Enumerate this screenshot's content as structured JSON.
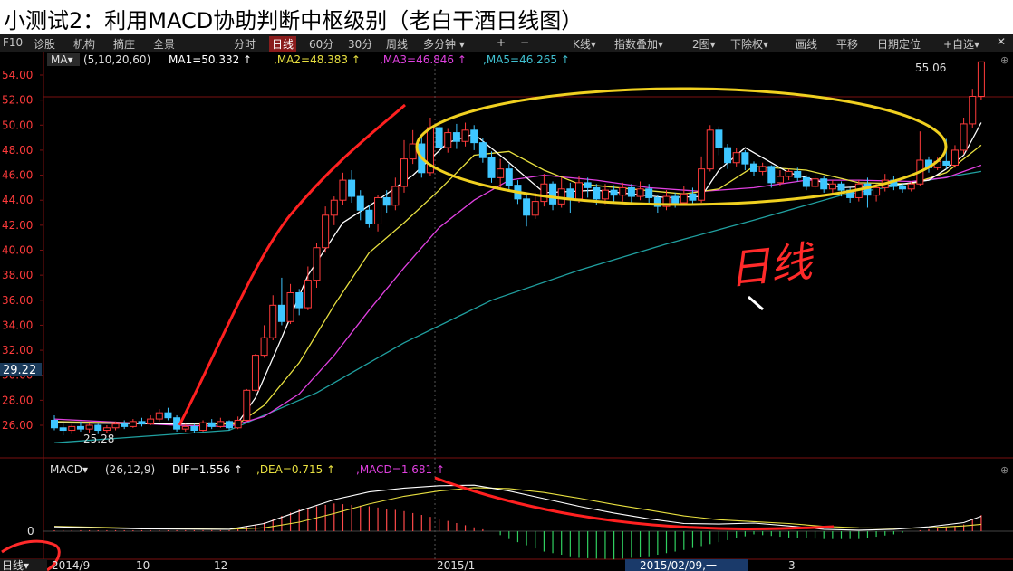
{
  "title": "小测试2：利用MACD协助判断中枢级别（老白干酒日线图）",
  "toolbar": {
    "left": [
      "F10",
      "诊股",
      "机构",
      "摘庄",
      "全景"
    ],
    "periods": [
      "分时",
      "日线",
      "60分",
      "30分",
      "周线",
      "多分钟 ▾",
      "+",
      "−"
    ],
    "active_period": "日线",
    "right": [
      "K线▾",
      "指数叠加▾",
      "2图▾",
      "下除权▾",
      "画线",
      "平移",
      "日期定位",
      "+自选▾"
    ]
  },
  "indicators": {
    "ma_label": "MA▾",
    "ma_params": "(5,10,20,60)",
    "ma1": "MA1=50.332 ↑",
    "ma2": ",MA2=48.383 ↑",
    "ma3": ",MA3=46.846 ↑",
    "ma5": ",MA5=46.265 ↑",
    "macd_label": "MACD▾",
    "macd_params": "(26,12,9)",
    "dif": "DIF=1.556 ↑",
    "dea": ",DEA=0.715 ↑",
    "macd": ",MACD=1.681 ↑"
  },
  "annotations": {
    "high_label": "55.06",
    "low_label": "25.28",
    "current_price": "29.22",
    "handwriting": "日线"
  },
  "axis": {
    "price_ticks": [
      "54.00",
      "52.00",
      "50.00",
      "48.00",
      "46.00",
      "44.00",
      "42.00",
      "40.00",
      "38.00",
      "36.00",
      "34.00",
      "32.00",
      "30.00",
      "28.00",
      "26.00"
    ],
    "macd_zero": "0",
    "date_labels": [
      "2014/9",
      "10",
      "12",
      "2015/1",
      "3"
    ],
    "period_button": "日线▾",
    "cursor_date": "2015/02/09,一"
  },
  "colors": {
    "up": "#ff3b3b",
    "down": "#3ec6ff",
    "ma1": "#ffffff",
    "ma2": "#e8e040",
    "ma3": "#e040e0",
    "ma5": "#20a0a0",
    "ellipse": "#f0d020",
    "trend": "#ff2020"
  },
  "chart_data": {
    "type": "candlestick",
    "title": "老白干酒日线图",
    "ylim": [
      24,
      55.5
    ],
    "price_ticks": [
      26,
      28,
      30,
      32,
      34,
      36,
      38,
      40,
      42,
      44,
      46,
      48,
      50,
      52,
      54
    ],
    "candles": [
      [
        26.4,
        25.8,
        26.8,
        25.6
      ],
      [
        25.8,
        25.6,
        26.2,
        25.2
      ],
      [
        25.6,
        25.9,
        26.1,
        25.3
      ],
      [
        25.9,
        25.7,
        26.3,
        25.5
      ],
      [
        25.7,
        26.0,
        26.2,
        25.4
      ],
      [
        26.0,
        25.6,
        26.1,
        25.3
      ],
      [
        25.6,
        25.8,
        26.0,
        25.4
      ],
      [
        25.8,
        26.1,
        26.3,
        25.6
      ],
      [
        26.1,
        25.9,
        26.4,
        25.7
      ],
      [
        25.9,
        26.3,
        26.5,
        25.8
      ],
      [
        26.3,
        26.1,
        26.6,
        25.9
      ],
      [
        26.1,
        26.5,
        26.8,
        26.0
      ],
      [
        26.5,
        27.0,
        27.3,
        26.3
      ],
      [
        27.0,
        26.6,
        27.4,
        26.4
      ],
      [
        26.6,
        25.7,
        26.8,
        25.5
      ],
      [
        25.7,
        25.9,
        26.1,
        25.5
      ],
      [
        25.9,
        25.6,
        26.1,
        25.4
      ],
      [
        25.6,
        26.2,
        26.4,
        25.5
      ],
      [
        26.2,
        25.9,
        26.5,
        25.7
      ],
      [
        25.9,
        26.3,
        26.6,
        25.8
      ],
      [
        26.3,
        25.8,
        26.4,
        25.6
      ],
      [
        25.8,
        26.4,
        26.7,
        25.7
      ],
      [
        26.4,
        28.8,
        28.9,
        26.3
      ],
      [
        28.8,
        31.6,
        31.7,
        28.7
      ],
      [
        31.6,
        33.0,
        34.0,
        31.4
      ],
      [
        33.0,
        35.6,
        36.4,
        32.8
      ],
      [
        35.6,
        34.3,
        37.8,
        34.0
      ],
      [
        34.3,
        36.6,
        37.3,
        34.1
      ],
      [
        36.6,
        35.4,
        36.9,
        34.8
      ],
      [
        35.4,
        37.6,
        38.7,
        35.2
      ],
      [
        37.6,
        40.2,
        40.6,
        37.0
      ],
      [
        40.2,
        42.8,
        43.5,
        39.8
      ],
      [
        42.8,
        44.0,
        44.3,
        42.0
      ],
      [
        44.0,
        45.6,
        46.2,
        43.6
      ],
      [
        45.6,
        44.3,
        46.4,
        43.8
      ],
      [
        44.3,
        43.2,
        44.8,
        42.4
      ],
      [
        43.2,
        42.1,
        43.6,
        41.8
      ],
      [
        42.1,
        44.2,
        44.4,
        41.5
      ],
      [
        44.2,
        43.6,
        44.8,
        43.0
      ],
      [
        43.6,
        45.1,
        45.8,
        43.2
      ],
      [
        45.1,
        47.3,
        48.8,
        44.6
      ],
      [
        47.3,
        48.5,
        49.6,
        46.9
      ],
      [
        48.5,
        46.2,
        49.2,
        45.8
      ],
      [
        46.2,
        49.8,
        50.6,
        45.9
      ],
      [
        49.8,
        48.2,
        50.4,
        47.6
      ],
      [
        48.2,
        49.4,
        49.7,
        47.8
      ],
      [
        49.4,
        48.7,
        50.1,
        48.1
      ],
      [
        48.7,
        49.6,
        50.2,
        48.3
      ],
      [
        49.6,
        48.6,
        50.0,
        48.0
      ],
      [
        48.6,
        47.4,
        49.0,
        47.0
      ],
      [
        47.4,
        45.8,
        47.9,
        45.4
      ],
      [
        45.8,
        46.5,
        47.3,
        45.0
      ],
      [
        46.5,
        45.2,
        46.9,
        44.7
      ],
      [
        45.2,
        44.1,
        45.6,
        43.7
      ],
      [
        44.1,
        42.8,
        44.5,
        41.9
      ],
      [
        42.8,
        43.9,
        44.6,
        42.5
      ],
      [
        43.9,
        45.3,
        46.1,
        43.5
      ],
      [
        45.3,
        43.7,
        45.5,
        43.2
      ],
      [
        43.7,
        44.9,
        45.8,
        43.4
      ],
      [
        44.9,
        44.1,
        45.4,
        43.0
      ],
      [
        44.1,
        45.4,
        45.9,
        43.8
      ],
      [
        45.4,
        45.0,
        45.8,
        44.2
      ],
      [
        45.0,
        44.1,
        45.3,
        43.6
      ],
      [
        44.1,
        44.8,
        45.3,
        43.7
      ],
      [
        44.8,
        44.4,
        45.2,
        43.9
      ],
      [
        44.4,
        45.0,
        45.4,
        43.9
      ],
      [
        45.0,
        44.3,
        45.3,
        43.8
      ],
      [
        44.3,
        44.9,
        45.5,
        44.0
      ],
      [
        44.9,
        44.2,
        45.3,
        43.6
      ],
      [
        44.2,
        43.5,
        44.4,
        43.0
      ],
      [
        43.5,
        44.3,
        44.8,
        43.2
      ],
      [
        44.3,
        43.8,
        44.6,
        43.4
      ],
      [
        43.8,
        44.5,
        45.1,
        43.6
      ],
      [
        44.5,
        44.0,
        45.0,
        43.7
      ],
      [
        44.0,
        46.5,
        47.5,
        43.8
      ],
      [
        46.5,
        49.6,
        50.0,
        46.3
      ],
      [
        49.6,
        48.2,
        49.9,
        47.6
      ],
      [
        48.2,
        47.0,
        48.5,
        46.5
      ],
      [
        47.0,
        47.8,
        48.2,
        46.7
      ],
      [
        47.8,
        46.9,
        48.0,
        46.4
      ],
      [
        46.9,
        46.3,
        47.1,
        45.9
      ],
      [
        46.3,
        46.7,
        47.0,
        46.0
      ],
      [
        46.7,
        45.4,
        46.8,
        45.0
      ],
      [
        45.4,
        45.9,
        46.4,
        45.1
      ],
      [
        45.9,
        46.3,
        46.5,
        45.6
      ],
      [
        46.3,
        45.8,
        46.6,
        45.5
      ],
      [
        45.8,
        45.1,
        46.0,
        44.8
      ],
      [
        45.1,
        45.7,
        46.1,
        44.9
      ],
      [
        45.7,
        44.9,
        45.9,
        44.6
      ],
      [
        44.9,
        45.3,
        45.6,
        44.5
      ],
      [
        45.3,
        44.8,
        45.5,
        44.3
      ],
      [
        44.8,
        44.2,
        45.0,
        43.8
      ],
      [
        44.2,
        45.3,
        45.6,
        43.9
      ],
      [
        45.3,
        44.4,
        45.8,
        43.4
      ],
      [
        44.4,
        45.0,
        45.3,
        43.9
      ],
      [
        45.0,
        45.6,
        46.1,
        44.7
      ],
      [
        45.6,
        45.1,
        45.9,
        44.8
      ],
      [
        45.1,
        44.9,
        45.3,
        44.6
      ],
      [
        44.9,
        45.3,
        45.5,
        44.7
      ],
      [
        45.3,
        47.2,
        49.5,
        45.1
      ],
      [
        47.2,
        46.6,
        47.5,
        46.2
      ],
      [
        46.6,
        47.1,
        47.4,
        46.4
      ],
      [
        47.1,
        46.8,
        48.9,
        46.5
      ],
      [
        46.8,
        48.0,
        48.4,
        46.6
      ],
      [
        48.0,
        50.1,
        50.6,
        47.7
      ],
      [
        50.1,
        52.3,
        52.9,
        49.8
      ],
      [
        52.3,
        55.06,
        55.06,
        52.0
      ]
    ],
    "ma1": [
      [
        0,
        26.2
      ],
      [
        14,
        26.1
      ],
      [
        21,
        26.2
      ],
      [
        23,
        28.2
      ],
      [
        26,
        33.0
      ],
      [
        29,
        38.0
      ],
      [
        33,
        42.2
      ],
      [
        37,
        44.0
      ],
      [
        41,
        46.0
      ],
      [
        45,
        48.6
      ],
      [
        48,
        49.3
      ],
      [
        52,
        47.0
      ],
      [
        56,
        44.6
      ],
      [
        62,
        44.8
      ],
      [
        70,
        44.2
      ],
      [
        74,
        44.3
      ],
      [
        76,
        46.4
      ],
      [
        79,
        48.2
      ],
      [
        84,
        46.2
      ],
      [
        90,
        45.0
      ],
      [
        96,
        45.2
      ],
      [
        100,
        45.6
      ],
      [
        102,
        46.5
      ],
      [
        104,
        47.6
      ],
      [
        106,
        50.2
      ]
    ],
    "ma2": [
      [
        0,
        26.3
      ],
      [
        14,
        26.1
      ],
      [
        21,
        26.1
      ],
      [
        24,
        27.6
      ],
      [
        28,
        31.0
      ],
      [
        32,
        35.6
      ],
      [
        36,
        39.8
      ],
      [
        40,
        42.2
      ],
      [
        44,
        44.8
      ],
      [
        48,
        47.6
      ],
      [
        52,
        47.9
      ],
      [
        56,
        46.4
      ],
      [
        60,
        45.3
      ],
      [
        66,
        44.9
      ],
      [
        72,
        44.5
      ],
      [
        76,
        44.9
      ],
      [
        80,
        46.7
      ],
      [
        86,
        46.4
      ],
      [
        92,
        45.4
      ],
      [
        98,
        45.3
      ],
      [
        102,
        46.2
      ],
      [
        106,
        48.4
      ]
    ],
    "ma3": [
      [
        0,
        26.5
      ],
      [
        14,
        26.0
      ],
      [
        20,
        25.9
      ],
      [
        24,
        26.7
      ],
      [
        28,
        28.5
      ],
      [
        32,
        31.6
      ],
      [
        36,
        35.2
      ],
      [
        40,
        38.6
      ],
      [
        44,
        41.8
      ],
      [
        48,
        44.0
      ],
      [
        52,
        45.6
      ],
      [
        56,
        46.0
      ],
      [
        62,
        45.6
      ],
      [
        68,
        45.0
      ],
      [
        74,
        44.7
      ],
      [
        80,
        45.0
      ],
      [
        86,
        45.6
      ],
      [
        92,
        45.6
      ],
      [
        98,
        45.5
      ],
      [
        102,
        45.8
      ],
      [
        106,
        46.8
      ]
    ],
    "ma5": [
      [
        0,
        24.6
      ],
      [
        10,
        25.1
      ],
      [
        20,
        25.6
      ],
      [
        30,
        28.6
      ],
      [
        40,
        32.6
      ],
      [
        50,
        36.0
      ],
      [
        60,
        38.4
      ],
      [
        70,
        40.5
      ],
      [
        80,
        42.4
      ],
      [
        90,
        44.4
      ],
      [
        100,
        45.6
      ],
      [
        106,
        46.3
      ]
    ],
    "macd": {
      "ylim": [
        -1.5,
        5.2
      ],
      "dif": [
        [
          0,
          0.45
        ],
        [
          10,
          0.25
        ],
        [
          20,
          0.2
        ],
        [
          24,
          0.8
        ],
        [
          28,
          2.1
        ],
        [
          32,
          3.3
        ],
        [
          36,
          4.1
        ],
        [
          40,
          4.5
        ],
        [
          44,
          4.75
        ],
        [
          48,
          4.8
        ],
        [
          52,
          4.2
        ],
        [
          56,
          3.4
        ],
        [
          60,
          2.6
        ],
        [
          64,
          1.9
        ],
        [
          68,
          1.3
        ],
        [
          72,
          0.8
        ],
        [
          76,
          0.75
        ],
        [
          80,
          0.85
        ],
        [
          84,
          0.55
        ],
        [
          88,
          0.2
        ],
        [
          92,
          0.1
        ],
        [
          96,
          0.2
        ],
        [
          100,
          0.45
        ],
        [
          104,
          0.9
        ],
        [
          106,
          1.56
        ]
      ],
      "dea": [
        [
          0,
          0.5
        ],
        [
          10,
          0.3
        ],
        [
          20,
          0.2
        ],
        [
          24,
          0.35
        ],
        [
          28,
          0.95
        ],
        [
          32,
          1.85
        ],
        [
          36,
          2.85
        ],
        [
          40,
          3.65
        ],
        [
          44,
          4.2
        ],
        [
          48,
          4.55
        ],
        [
          52,
          4.45
        ],
        [
          56,
          4.05
        ],
        [
          60,
          3.45
        ],
        [
          64,
          2.8
        ],
        [
          68,
          2.2
        ],
        [
          72,
          1.6
        ],
        [
          76,
          1.2
        ],
        [
          80,
          1.0
        ],
        [
          84,
          0.8
        ],
        [
          88,
          0.5
        ],
        [
          92,
          0.35
        ],
        [
          96,
          0.3
        ],
        [
          100,
          0.35
        ],
        [
          104,
          0.55
        ],
        [
          106,
          0.72
        ]
      ],
      "hist_profile": [
        [
          0,
          0.1
        ],
        [
          20,
          0.1
        ],
        [
          24,
          0.9
        ],
        [
          28,
          2.3
        ],
        [
          32,
          2.9
        ],
        [
          36,
          2.6
        ],
        [
          40,
          2.1
        ],
        [
          44,
          1.3
        ],
        [
          48,
          0.4
        ],
        [
          50,
          0.0
        ],
        [
          52,
          -0.5
        ],
        [
          56,
          -1.3
        ],
        [
          60,
          -1.7
        ],
        [
          64,
          -1.8
        ],
        [
          68,
          -1.6
        ],
        [
          72,
          -1.2
        ],
        [
          76,
          -0.7
        ],
        [
          80,
          -0.2
        ],
        [
          84,
          -0.4
        ],
        [
          88,
          -0.5
        ],
        [
          92,
          -0.5
        ],
        [
          96,
          -0.2
        ],
        [
          100,
          0.2
        ],
        [
          104,
          0.7
        ],
        [
          106,
          1.68
        ]
      ]
    }
  }
}
